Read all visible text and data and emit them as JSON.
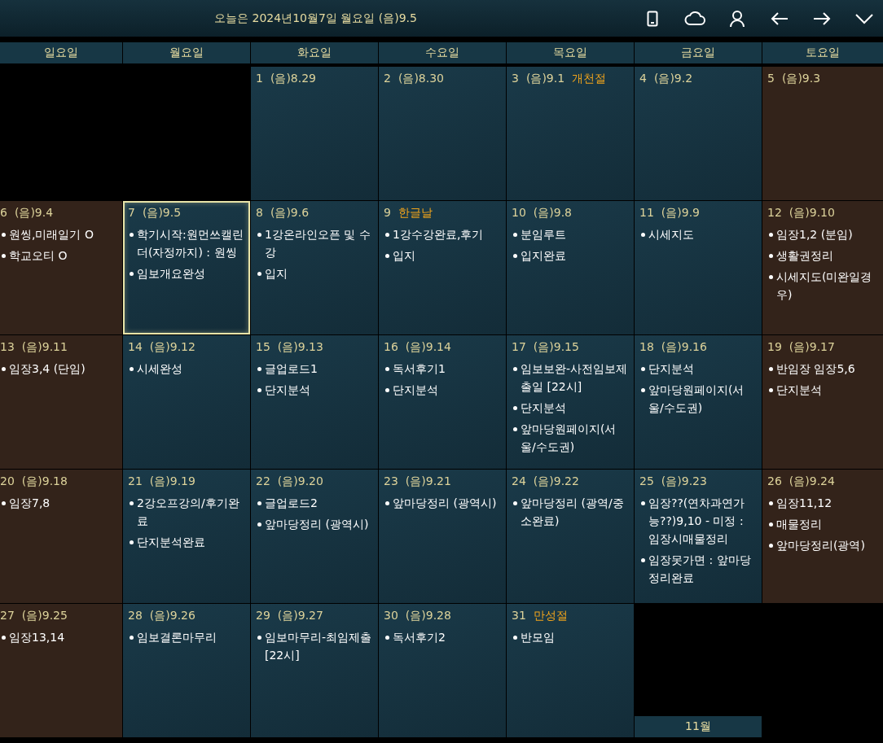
{
  "header": {
    "title": "오늘은 2024년10월7일 월요일 (음)9.5"
  },
  "weekdays": [
    "일요일",
    "월요일",
    "화요일",
    "수요일",
    "목요일",
    "금요일",
    "토요일"
  ],
  "weeks": [
    [
      {
        "kind": "empty"
      },
      {
        "kind": "empty"
      },
      {
        "kind": "weekday",
        "day": "1",
        "lunar": "(음)8.29",
        "selected": false
      },
      {
        "kind": "weekday",
        "day": "2",
        "lunar": "(음)8.30",
        "selected": false
      },
      {
        "kind": "weekday",
        "day": "3",
        "lunar": "(음)9.1",
        "holiday": "개천절",
        "selected": false
      },
      {
        "kind": "weekday",
        "day": "4",
        "lunar": "(음)9.2",
        "selected": false
      },
      {
        "kind": "weekend",
        "day": "5",
        "lunar": "(음)9.3",
        "selected": false
      }
    ],
    [
      {
        "kind": "weekend",
        "day": "6",
        "lunar": "(음)9.4",
        "selected": false,
        "events": [
          "원씽,미래일기 O",
          "학교오티 O"
        ]
      },
      {
        "kind": "weekday",
        "day": "7",
        "lunar": "(음)9.5",
        "selected": true,
        "events": [
          "학기시작:원먼쓰캘린더(자정까지) : 원씽",
          "임보개요완성"
        ]
      },
      {
        "kind": "weekday",
        "day": "8",
        "lunar": "(음)9.6",
        "selected": false,
        "events": [
          "1강온라인오픈 및 수강",
          "입지"
        ]
      },
      {
        "kind": "weekday",
        "day": "9",
        "holiday": "한글날",
        "selected": false,
        "events": [
          "1강수강완료,후기",
          "입지"
        ]
      },
      {
        "kind": "weekday",
        "day": "10",
        "lunar": "(음)9.8",
        "selected": false,
        "events": [
          "분임루트",
          "입지완료"
        ]
      },
      {
        "kind": "weekday",
        "day": "11",
        "lunar": "(음)9.9",
        "selected": false,
        "events": [
          "시세지도"
        ]
      },
      {
        "kind": "weekend",
        "day": "12",
        "lunar": "(음)9.10",
        "selected": false,
        "events": [
          "임장1,2 (분임)",
          "생활권정리",
          "시세지도(미완일경우)"
        ]
      }
    ],
    [
      {
        "kind": "weekend",
        "day": "13",
        "lunar": "(음)9.11",
        "selected": false,
        "events": [
          "임장3,4 (단임)"
        ]
      },
      {
        "kind": "weekday",
        "day": "14",
        "lunar": "(음)9.12",
        "selected": false,
        "events": [
          "시세완성"
        ]
      },
      {
        "kind": "weekday",
        "day": "15",
        "lunar": "(음)9.13",
        "selected": false,
        "events": [
          "글업로드1",
          "단지분석"
        ]
      },
      {
        "kind": "weekday",
        "day": "16",
        "lunar": "(음)9.14",
        "selected": false,
        "events": [
          "독서후기1",
          "단지분석"
        ]
      },
      {
        "kind": "weekday",
        "day": "17",
        "lunar": "(음)9.15",
        "selected": false,
        "events": [
          "임보보완-사전임보제출일 [22시]",
          "단지분석",
          "앞마당원페이지(서울/수도권)"
        ]
      },
      {
        "kind": "weekday",
        "day": "18",
        "lunar": "(음)9.16",
        "selected": false,
        "events": [
          "단지분석",
          "앞마당원페이지(서울/수도권)"
        ]
      },
      {
        "kind": "weekend",
        "day": "19",
        "lunar": "(음)9.17",
        "selected": false,
        "events": [
          "반임장 임장5,6",
          "단지분석"
        ]
      }
    ],
    [
      {
        "kind": "weekend",
        "day": "20",
        "lunar": "(음)9.18",
        "selected": false,
        "events": [
          "임장7,8"
        ]
      },
      {
        "kind": "weekday",
        "day": "21",
        "lunar": "(음)9.19",
        "selected": false,
        "events": [
          "2강오프강의/후기완료",
          "단지분석완료"
        ]
      },
      {
        "kind": "weekday",
        "day": "22",
        "lunar": "(음)9.20",
        "selected": false,
        "events": [
          "글업로드2",
          "앞마당정리 (광역시)"
        ]
      },
      {
        "kind": "weekday",
        "day": "23",
        "lunar": "(음)9.21",
        "selected": false,
        "events": [
          "앞마당정리 (광역시)"
        ]
      },
      {
        "kind": "weekday",
        "day": "24",
        "lunar": "(음)9.22",
        "selected": false,
        "events": [
          "앞마당정리 (광역/중소완료)"
        ]
      },
      {
        "kind": "weekday",
        "day": "25",
        "lunar": "(음)9.23",
        "selected": false,
        "events": [
          "임장??(연차과연가능??)9,10 - 미정 : 임장시매물정리",
          "임장못가면 : 앞마당정리완료"
        ]
      },
      {
        "kind": "weekend",
        "day": "26",
        "lunar": "(음)9.24",
        "selected": false,
        "events": [
          "임장11,12",
          "매물정리",
          "앞마당정리(광역)"
        ]
      }
    ],
    [
      {
        "kind": "weekend",
        "day": "27",
        "lunar": "(음)9.25",
        "selected": false,
        "events": [
          "임장13,14"
        ]
      },
      {
        "kind": "weekday",
        "day": "28",
        "lunar": "(음)9.26",
        "selected": false,
        "events": [
          "임보결론마무리"
        ]
      },
      {
        "kind": "weekday",
        "day": "29",
        "lunar": "(음)9.27",
        "selected": false,
        "events": [
          "임보마무리-최임제출[22시]"
        ]
      },
      {
        "kind": "weekday",
        "day": "30",
        "lunar": "(음)9.28",
        "selected": false,
        "events": [
          "독서후기2"
        ]
      },
      {
        "kind": "weekday",
        "day": "31",
        "holiday": "만성절",
        "selected": false,
        "events": [
          "반모임"
        ]
      },
      {
        "kind": "empty",
        "label": "11월"
      },
      {
        "kind": "empty"
      }
    ]
  ]
}
